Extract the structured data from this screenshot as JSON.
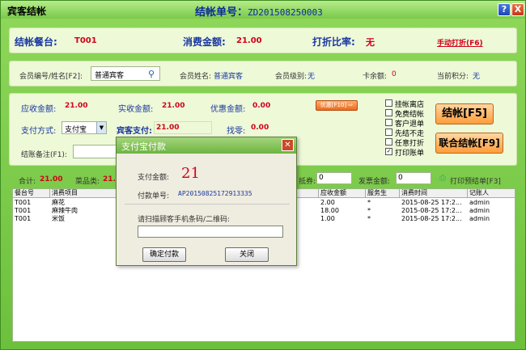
{
  "window": {
    "title": "宾客结帐",
    "bill_no_label": "结帐单号：",
    "bill_no": "ZD201508250003",
    "help_btn": "?",
    "close_btn": "X"
  },
  "header": {
    "table_label": "结帐餐台:",
    "table_value": "T001",
    "amount_label": "消费金额:",
    "amount_value": "21.00",
    "discount_label": "打折比率:",
    "discount_value": "无",
    "manual_discount": "手动打折(F6)"
  },
  "member": {
    "id_label": "会员编号/姓名[F2]:",
    "id_value": "普通宾客",
    "name_label": "会员姓名:",
    "name_value": "普通宾客",
    "level_label": "会员级别:",
    "level_value": "无",
    "card_balance_label": "卡余额:",
    "card_balance_value": "0",
    "points_label": "当前积分:",
    "points_value": "无"
  },
  "payment": {
    "receivable_label": "应收金额:",
    "receivable_value": "21.00",
    "received_label": "实收金额:",
    "received_value": "21.00",
    "preferential_label": "优惠金额:",
    "preferential_value": "0.00",
    "coupon_btn": "优惠[F10]",
    "method_label": "支付方式:",
    "method_value": "支付宝",
    "guest_pay_label": "宾客支付:",
    "guest_pay_value": "21.00",
    "change_label": "找零:",
    "change_value": "0.00",
    "remark_label": "结账备注(F1):"
  },
  "options": [
    {
      "label": "挂帐离店",
      "checked": false
    },
    {
      "label": "免费结帐",
      "checked": false
    },
    {
      "label": "客户退单",
      "checked": false
    },
    {
      "label": "先结不走",
      "checked": false
    },
    {
      "label": "任意打折",
      "checked": false
    },
    {
      "label": "打印账单",
      "checked": true
    }
  ],
  "actions": {
    "checkout": "结帐[F5]",
    "joint_checkout": "联合结帐[F9]"
  },
  "summary": {
    "total_label": "合计:",
    "total_value": "21.00",
    "dish_label": "菜品类:",
    "dish_value": "21.",
    "voucher_label": "抵券:",
    "voucher_value": "0",
    "invoice_label": "发票金额:",
    "invoice_value": "0",
    "print_pre": "打印预结单[F3]"
  },
  "grid": {
    "columns": [
      "餐台号",
      "消费项目",
      "量",
      "应收金额",
      "服务生",
      "消费时间",
      "记账人"
    ],
    "rows": [
      [
        "T001",
        "麻花",
        "",
        "2.00",
        "*",
        "2015-08-25 17:2...",
        "admin"
      ],
      [
        "T001",
        "麻辣牛肉",
        "",
        "18.00",
        "*",
        "2015-08-25 17:2...",
        "admin"
      ],
      [
        "T001",
        "米饭",
        "",
        "1.00",
        "*",
        "2015-08-25 17:2...",
        "admin"
      ]
    ]
  },
  "dialog": {
    "title": "支付宝付款",
    "amount_label": "支付金额:",
    "amount_value": "21",
    "pay_no_label": "付款单号:",
    "pay_no_value": "AP20150825172913335",
    "scan_label": "请扫描顾客手机条码/二维码:",
    "confirm": "确定付款",
    "close": "关闭"
  }
}
